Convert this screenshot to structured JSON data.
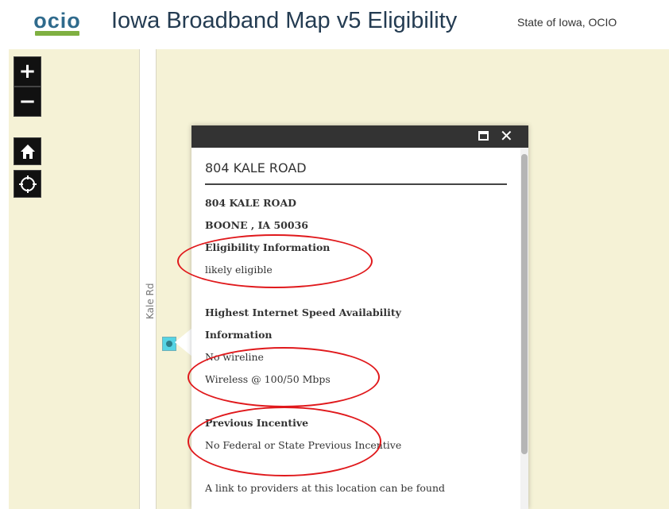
{
  "header": {
    "logo_text": "ocio",
    "title": "Iowa Broadband Map v5 Eligibility",
    "org": "State of Iowa, OCIO"
  },
  "map": {
    "road_label": "Kale Rd",
    "controls": {
      "zoom_in": "+",
      "zoom_out": "−"
    }
  },
  "popup": {
    "title": "804 KALE ROAD",
    "address_line1": "804 KALE ROAD",
    "address_line2": "BOONE , IA  50036",
    "eligibility_heading": "Eligibility Information",
    "eligibility_value": "likely eligible",
    "speed_heading_1": "Highest Internet Speed Availability",
    "speed_heading_2": "Information",
    "speed_wireline": "No wireline",
    "speed_wireless": "Wireless @ 100/50 Mbps",
    "incentive_heading": "Previous Incentive",
    "incentive_value": "No Federal or State Previous Incentive",
    "link_text": "A link to providers at this location can be found"
  },
  "colors": {
    "map_background": "#f5f2d6",
    "annotation": "#e0191c",
    "marker": "#55d4e4",
    "logo_blue": "#2f6a8c",
    "logo_green": "#7fb041"
  }
}
